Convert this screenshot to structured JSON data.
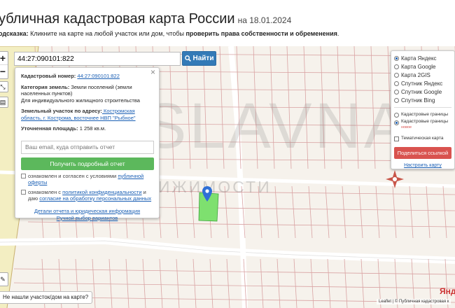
{
  "header": {
    "title": "убличная кадастровая карта России",
    "date": "на 18.01.2024",
    "hint_prefix": "одсказка:",
    "hint_text": " Кликните на карте на любой участок или дом, чтобы ",
    "hint_bold": "проверить права собственности и обременения",
    "hint_end": "."
  },
  "search": {
    "value": "44:27:090101:822",
    "button_label": "Найти"
  },
  "zoom": {
    "plus": "+",
    "minus": "−"
  },
  "popup": {
    "cadastral_label": "Кадастровый номер:",
    "cadastral_value": "44:27:090101:822",
    "category_label": "Категория земель:",
    "category_value": " Земли поселений (земли населенных пунктов)",
    "usage": "Для индивидуального жилищного строительства",
    "address_label": "Земельный участок по адресу:",
    "address_value": " Костромская область, г. Кострома, восточнее НВП \"Рыбное\"",
    "area_label": "Уточненная площадь:",
    "area_value": " 1 258 кв.м.",
    "email_placeholder": "Ваш email, куда отправить отчет",
    "report_button": "Получить подробный отчет",
    "consent1_prefix": "ознакомлен и согласен с условиями ",
    "consent1_link": "публичной оферты",
    "consent2_prefix": "ознакомлен с ",
    "consent2_link": "политикой конфиденциальности",
    "consent2_mid": " и даю ",
    "consent2_link2": "согласие на обработку персональных данных",
    "link_details": "Детали отчета и юридическая информация",
    "link_manual": "Ручной выбор вариантов"
  },
  "layers": {
    "options": [
      "Карта Яндекс",
      "Карта Google",
      "Карта 2GIS",
      "Спутник Яндекс",
      "Спутник Google",
      "Спутник Bing"
    ],
    "selected_index": 0,
    "cadastral_borders": "Кадастровые границы",
    "cadastral_borders_new": "Кадастровые границы",
    "new_badge": "новое",
    "thematic": "Тематическая карта",
    "share_button": "Поделиться ссылкой",
    "setup_link": "Настроить карту"
  },
  "footer": {
    "not_found": "Не нашли участок/дом на карте?",
    "attribution": "Leaflet | © Публичная кадастровая к",
    "yandex": "Янде"
  },
  "watermark": {
    "big": "SLAVNA",
    "small": "ОЦЕНКА НЕДВИЖИМОСТИ"
  },
  "colors": {
    "accent": "#337ab7",
    "report_green": "#5cb85c",
    "share_red": "#d9534f",
    "parcel_fill": "#7ee06f",
    "parcel_line": "#d9a3a3",
    "marker": "#2f6fd6"
  }
}
